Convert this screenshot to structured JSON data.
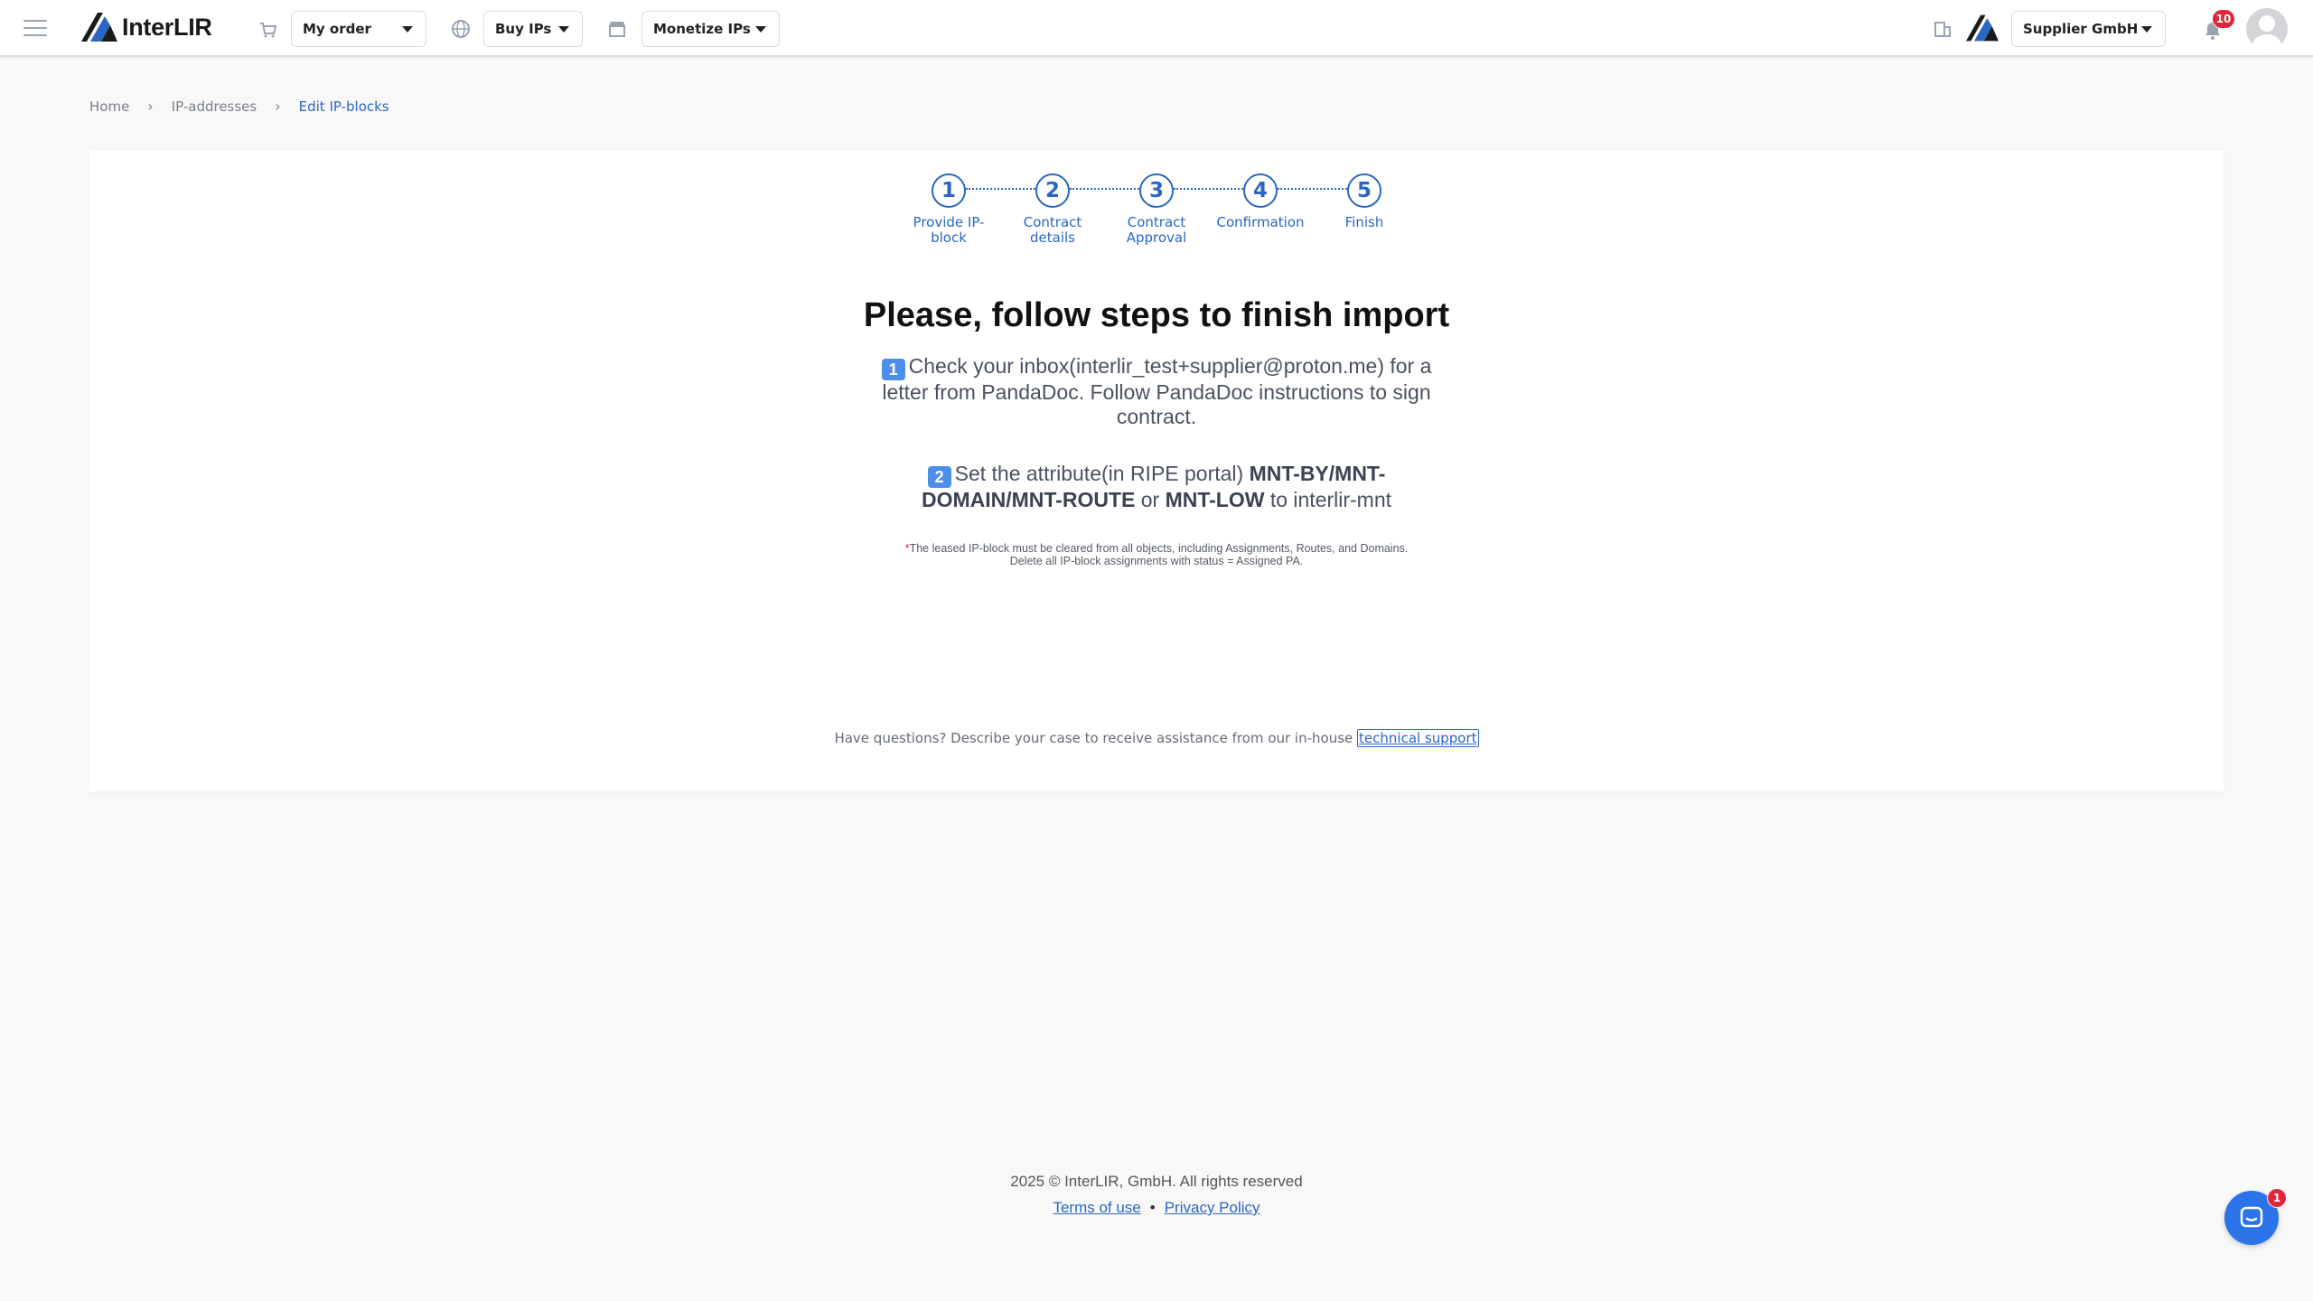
{
  "header": {
    "logo_text": "InterLIR",
    "my_order": "My order",
    "buy_ips": "Buy IPs",
    "monetize_ips": "Monetize IPs",
    "company": "Supplier GmbH",
    "notifications_count": "10"
  },
  "breadcrumb": [
    "Home",
    "IP-addresses",
    "Edit IP-blocks"
  ],
  "stepper": [
    {
      "num": "1",
      "label": "Provide IP-block"
    },
    {
      "num": "2",
      "label": "Contract details"
    },
    {
      "num": "3",
      "label": "Contract Approval"
    },
    {
      "num": "4",
      "label": "Confirmation"
    },
    {
      "num": "5",
      "label": "Finish"
    }
  ],
  "main": {
    "title": "Please, follow steps to finish import",
    "step1_num": "1",
    "step1_text": "Check your inbox(interlir_test+supplier@proton.me) for a letter from PandaDoc. Follow PandaDoc instructions to sign contract.",
    "step2_num": "2",
    "step2_pre": "Set the attribute(in RIPE portal)",
    "step2_bold1": "MNT-BY/MNT-DOMAIN/MNT-ROUTE",
    "step2_or": "or",
    "step2_bold2": "MNT-LOW",
    "step2_post": "to interlir-mnt",
    "note_star": "*",
    "note_line1": "The leased IP-block must be cleared from all objects, including Assignments, Routes, and Domains.",
    "note_line2": "Delete all IP-block assignments with status = Assigned PA.",
    "help_text": "Have questions? Describe your case to receive assistance from our in-house",
    "help_link": "technical support"
  },
  "footer": {
    "copyright": "2025 © InterLIR, GmbH. All rights reserved",
    "terms": "Terms of use",
    "separator": "•",
    "privacy": "Privacy Policy"
  },
  "chat": {
    "badge": "1"
  },
  "colors": {
    "accent": "#2a66c3",
    "badge": "#e0253c",
    "chat": "#2a73e8"
  }
}
